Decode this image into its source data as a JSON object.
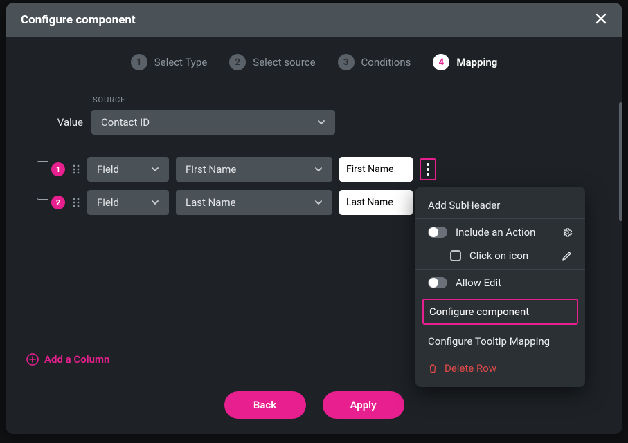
{
  "header": {
    "title": "Configure component"
  },
  "steps": [
    {
      "num": "1",
      "label": "Select Type"
    },
    {
      "num": "2",
      "label": "Select source"
    },
    {
      "num": "3",
      "label": "Conditions"
    },
    {
      "num": "4",
      "label": "Mapping"
    }
  ],
  "source": {
    "heading": "SOURCE",
    "valueLabel": "Value",
    "valueSelected": "Contact ID"
  },
  "rows": [
    {
      "badge": "1",
      "type": "Field",
      "source": "First Name",
      "display": "First Name"
    },
    {
      "badge": "2",
      "type": "Field",
      "source": "Last Name",
      "display": "Last Name"
    }
  ],
  "addColumn": "Add a Column",
  "footer": {
    "back": "Back",
    "apply": "Apply"
  },
  "popover": {
    "addSubHeader": "Add SubHeader",
    "includeAction": "Include an Action",
    "clickOnIcon": "Click on icon",
    "allowEdit": "Allow Edit",
    "configureComponent": "Configure component",
    "configureTooltip": "Configure Tooltip Mapping",
    "deleteRow": "Delete Row"
  }
}
